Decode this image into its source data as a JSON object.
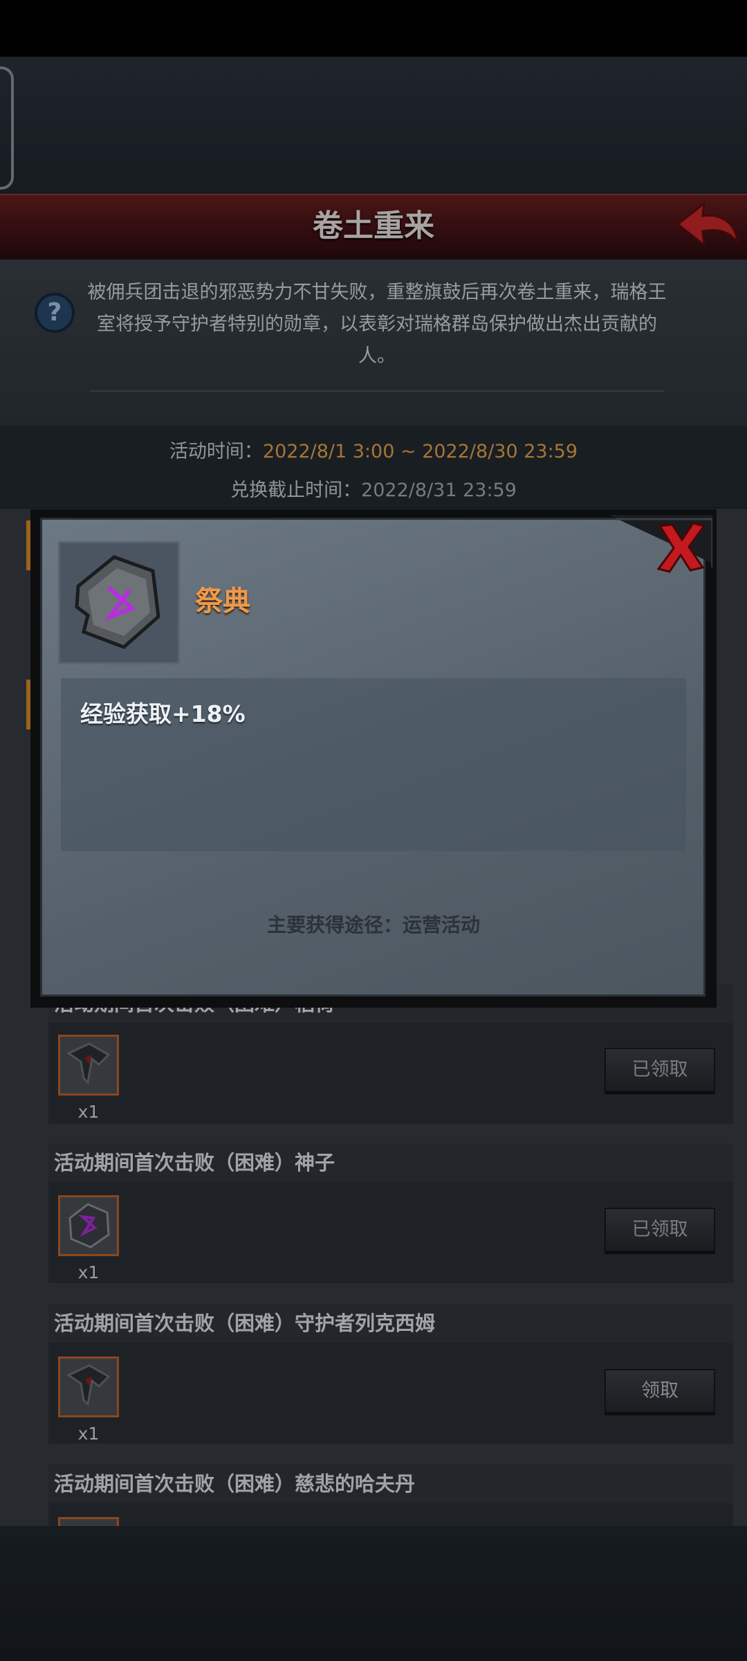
{
  "header": {
    "title": "卷土重来"
  },
  "info": {
    "description": "被佣兵团击退的邪恶势力不甘失败，重整旗鼓后再次卷土重来，瑞格王室将授予守护者特别的勋章，以表彰对瑞格群岛保护做出杰出贡献的人。",
    "time_label": "活动时间：",
    "time_value": "2022/8/1 3:00 ~ 2022/8/30 23:59",
    "deadline_label": "兑换截止时间：",
    "deadline_value": "2022/8/31 23:59"
  },
  "tasks": [
    {
      "title": "活动期间首次击败（困难）稻荷",
      "qty": "x1",
      "button": "已领取",
      "icon": "dark-rune-red"
    },
    {
      "title": "活动期间首次击败（困难）神子",
      "qty": "x1",
      "button": "已领取",
      "icon": "purple-rune-stone"
    },
    {
      "title": "活动期间首次击败（困难）守护者列克西姆",
      "qty": "x1",
      "button": "领取",
      "icon": "dark-rune-red"
    },
    {
      "title": "活动期间首次击败（困难）慈悲的哈夫丹",
      "qty": "",
      "button": "",
      "icon": "dark-rune-red"
    }
  ],
  "dialog": {
    "item_name": "祭典",
    "effect": "经验获取+18%",
    "source": "主要获得途径：运营活动",
    "icon": "purple-rune-stone"
  },
  "colors": {
    "accent_orange": "#e8a24a",
    "title_red": "#5a1a1c",
    "item_name_orange": "#f09a4a"
  }
}
